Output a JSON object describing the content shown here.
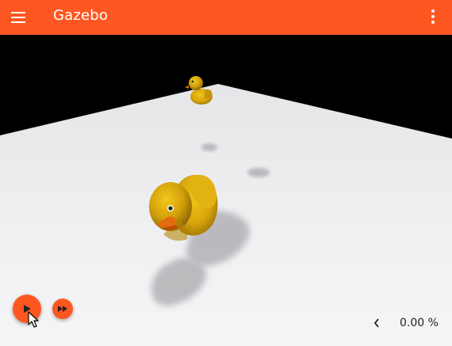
{
  "header": {
    "title": "Gazebo",
    "menu_icon": "hamburger-menu-icon",
    "more_icon": "vertical-dots-icon",
    "background_color": "#ff5722"
  },
  "scene": {
    "sky_color": "#000000",
    "ground_color": "#ededef",
    "models": [
      "rubber-duck-near",
      "rubber-duck-far"
    ]
  },
  "controls": {
    "play_icon": "play-icon",
    "fast_forward_icon": "fast-forward-icon",
    "collapse_icon": "chevron-left-icon",
    "real_time_factor": "0.00 %",
    "accent_color": "#ff5722"
  }
}
